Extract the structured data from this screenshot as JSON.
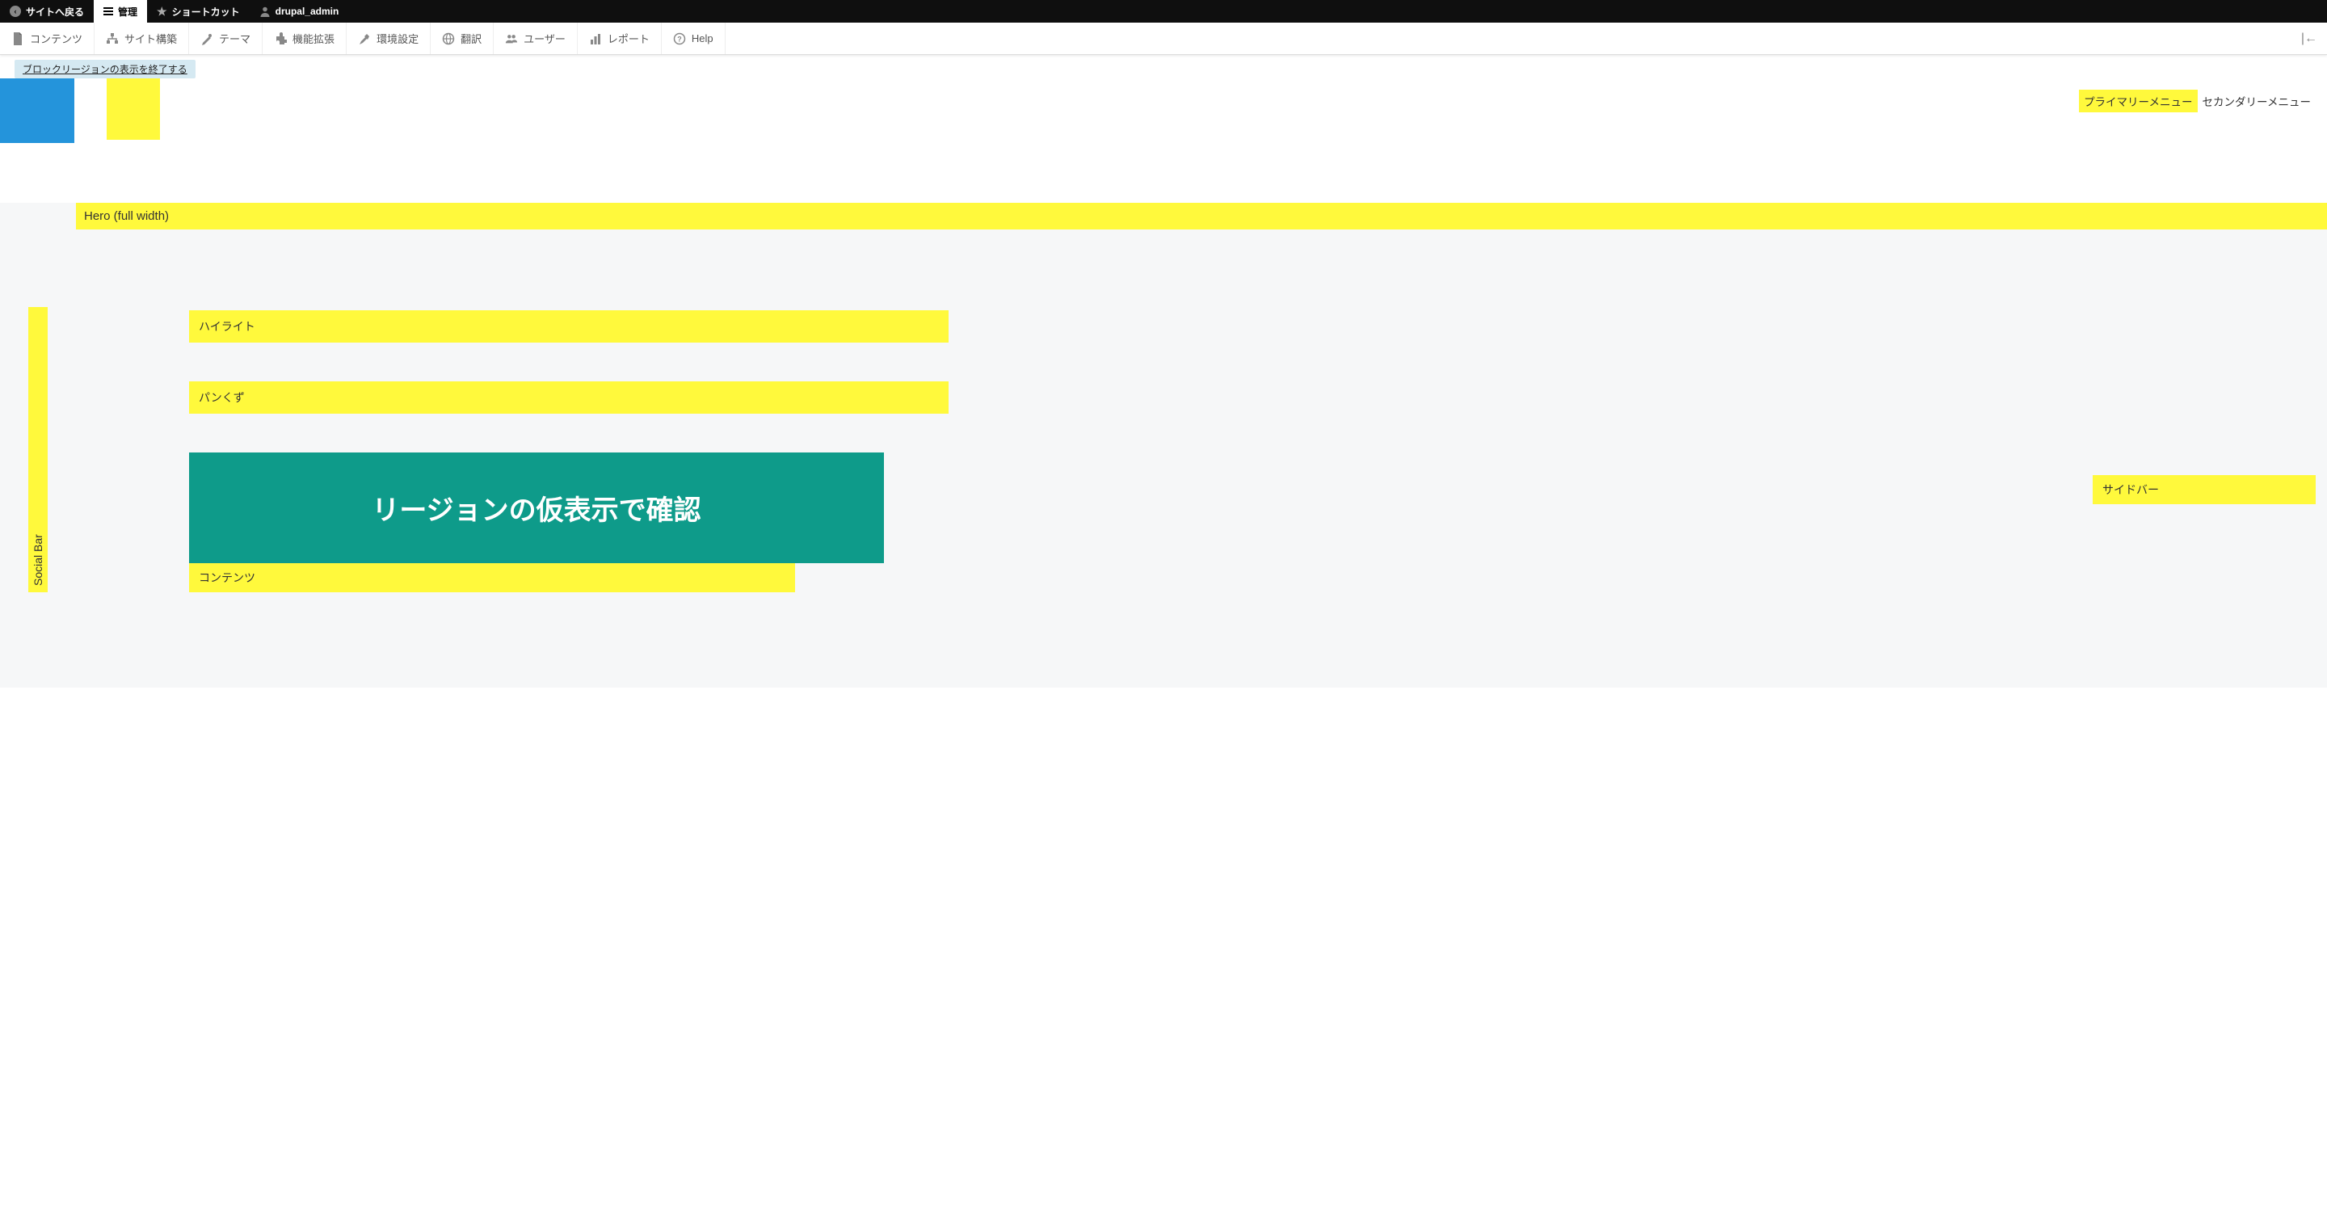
{
  "toolbar": {
    "back": "サイトへ戻る",
    "manage": "管理",
    "shortcuts": "ショートカット",
    "user": "drupal_admin"
  },
  "admin_menu": {
    "content": "コンテンツ",
    "structure": "サイト構築",
    "appearance": "テーマ",
    "extend": "機能拡張",
    "config": "環境設定",
    "translate": "翻訳",
    "people": "ユーザー",
    "reports": "レポート",
    "help": "Help"
  },
  "exit_link": "ブロックリージョンの表示を終了する",
  "menus": {
    "primary": "プライマリーメニュー",
    "secondary": "セカンダリーメニュー"
  },
  "regions": {
    "hero": "Hero (full width)",
    "social": "Social Bar",
    "highlighted": "ハイライト",
    "breadcrumb": "パンくず",
    "content": "コンテンツ",
    "sidebar": "サイドバー"
  },
  "banner": "リージョンの仮表示で確認"
}
